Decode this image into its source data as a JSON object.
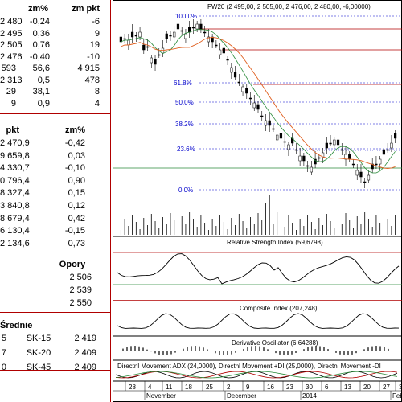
{
  "table1": {
    "headers": [
      "zm%",
      "zm pkt"
    ],
    "rows": [
      [
        "2 480",
        "-0,24",
        "-6"
      ],
      [
        "2 495",
        "0,36",
        "9"
      ],
      [
        "2 505",
        "0,76",
        "19"
      ],
      [
        "2 476",
        "-0,40",
        "-10"
      ],
      [
        "593",
        "56,6",
        "4 915"
      ],
      [
        "2 313",
        "0,5",
        "478"
      ],
      [
        "29",
        "38,1",
        "8"
      ],
      [
        "9",
        "0,9",
        "4"
      ]
    ]
  },
  "table2": {
    "headers": [
      "pkt",
      "zm%"
    ],
    "rows": [
      [
        "2 470,9",
        "-0,42"
      ],
      [
        "9 659,8",
        "0,03"
      ],
      [
        "4 330,7",
        "-0,10"
      ],
      [
        "0 796,4",
        "0,90"
      ],
      [
        "8 327,4",
        "0,15"
      ],
      [
        "3 840,8",
        "0,12"
      ],
      [
        "8 679,4",
        "0,42"
      ],
      [
        "6 130,4",
        "-0,15"
      ],
      [
        "2 134,6",
        "0,73"
      ]
    ]
  },
  "opory": {
    "title": "Opory",
    "values": [
      "2 506",
      "2 539",
      "2 550"
    ]
  },
  "srednie": {
    "title": "Średnie",
    "rows": [
      [
        "5",
        "SK-15",
        "2 419"
      ],
      [
        "7",
        "SK-20",
        "2 409"
      ],
      [
        "0",
        "SK-45",
        "2 409"
      ]
    ]
  },
  "chart": {
    "title": "FW20 (2 495,00, 2 505,00, 2 476,00, 2 480,00, -6,00000)",
    "fib_labels": [
      "100.0%",
      "61.8%",
      "50.0%",
      "38.2%",
      "23.6%",
      "0.0%"
    ],
    "rsi_title": "Relative Strength Index (59,6798)",
    "composite_title": "Composite Index (207,248)",
    "deriv_title": "Derivative Oscillator (6,64288)",
    "dmi_title": "Directnl Movement ADX (24,0000), Directnl Movement +DI (25,0000), Directnl Movement -DI",
    "x_day_labels": [
      "28",
      "4",
      "11",
      "18",
      "25",
      "2",
      "9",
      "16",
      "23",
      "30",
      "6",
      "13",
      "20",
      "27",
      "3"
    ],
    "x_month_labels": [
      "November",
      "December",
      "2014",
      "February"
    ]
  },
  "colors": {
    "accent_red": "#b00000",
    "fib_blue": "#0000cc",
    "ma_orange": "#e06020",
    "ma_green": "#2a8a3a",
    "grid_gray": "#999999"
  }
}
